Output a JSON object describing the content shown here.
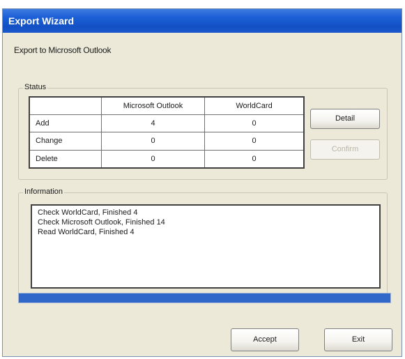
{
  "window": {
    "title": "Export Wizard",
    "subtitle": "Export to Microsoft Outlook"
  },
  "status": {
    "label": "Status",
    "columns": [
      "",
      "Microsoft Outlook",
      "WorldCard"
    ],
    "rows": [
      {
        "label": "Add",
        "outlook": "4",
        "worldcard": "0"
      },
      {
        "label": "Change",
        "outlook": "0",
        "worldcard": "0"
      },
      {
        "label": "Delete",
        "outlook": "0",
        "worldcard": "0"
      }
    ],
    "detail_button": "Detail",
    "confirm_button": "Confirm"
  },
  "information": {
    "label": "Information",
    "lines": [
      "Check WorldCard, Finished 4",
      "Check Microsoft Outlook, Finished 14",
      "Read WorldCard, Finished 4"
    ]
  },
  "progress": {
    "value_percent": 100
  },
  "footer": {
    "accept_button": "Accept",
    "exit_button": "Exit"
  },
  "colors": {
    "title_bar": "#1c5fd6",
    "progress": "#2f68c8",
    "dialog_bg": "#ece9d8"
  }
}
